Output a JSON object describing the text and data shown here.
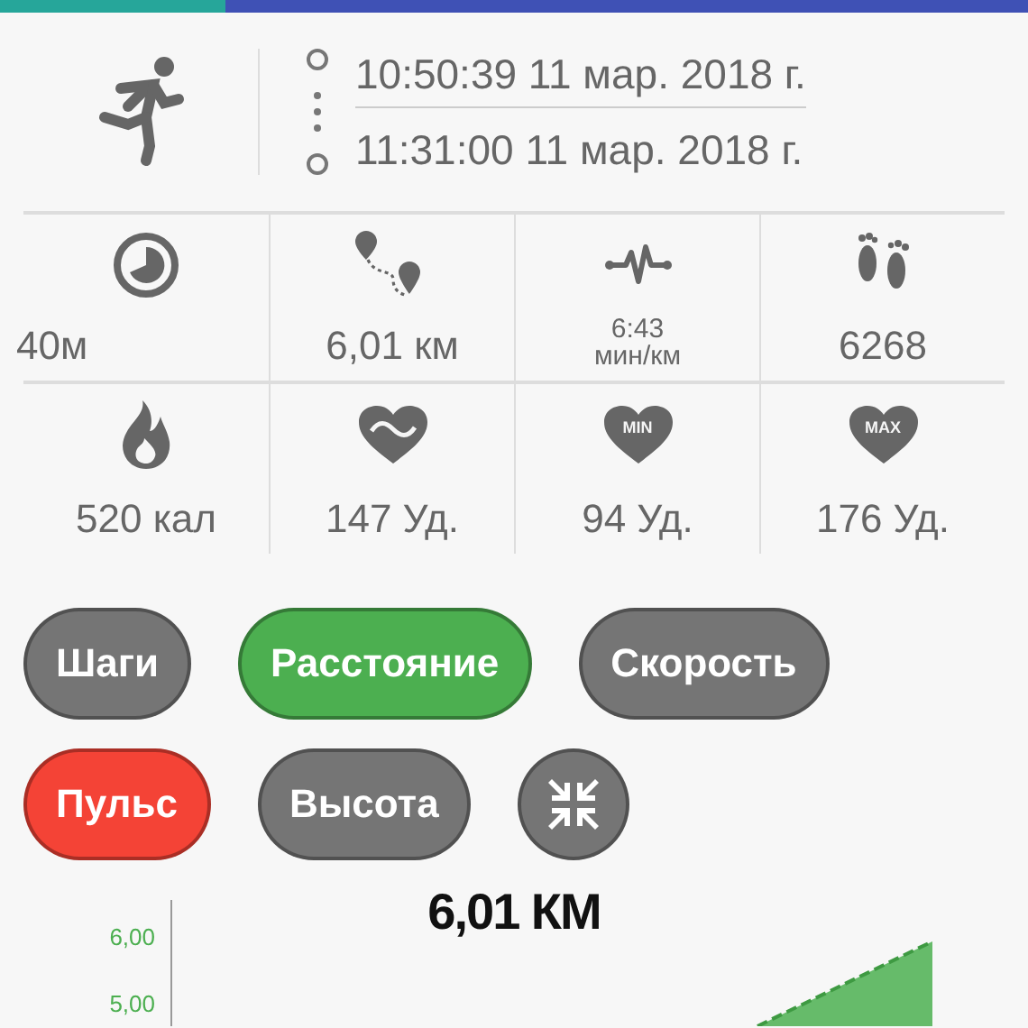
{
  "top_bar": {
    "level": 0.22
  },
  "session": {
    "start": "10:50:39  11 мар. 2018 г.",
    "end": "11:31:00  11 мар. 2018 г."
  },
  "stats": [
    {
      "kind": "time",
      "value": "40м"
    },
    {
      "kind": "distance",
      "value": "6,01 км"
    },
    {
      "kind": "pace",
      "value": "6:43",
      "unit": "мин/км"
    },
    {
      "kind": "steps",
      "value": "6268"
    },
    {
      "kind": "calories",
      "value": "520 кал"
    },
    {
      "kind": "avg_pulse",
      "value": "147 Уд."
    },
    {
      "kind": "min_pulse",
      "value": "94 Уд.",
      "icon_text": "MIN"
    },
    {
      "kind": "max_pulse",
      "value": "176 Уд.",
      "icon_text": "MAX"
    }
  ],
  "chips": [
    {
      "kind": "text",
      "label": "Шаги",
      "color": "#757575"
    },
    {
      "kind": "text",
      "label": "Расстояние",
      "color": "#4caf50"
    },
    {
      "kind": "text",
      "label": "Скорость",
      "color": "#757575"
    },
    {
      "kind": "text",
      "label": "Пульс",
      "color": "#f44336"
    },
    {
      "kind": "text",
      "label": "Высота",
      "color": "#757575"
    },
    {
      "kind": "collapse",
      "color": "#757575"
    }
  ],
  "chart": {
    "title": "6,01 КМ",
    "y_tick_labels": [
      "6,00",
      "5,00"
    ]
  }
}
